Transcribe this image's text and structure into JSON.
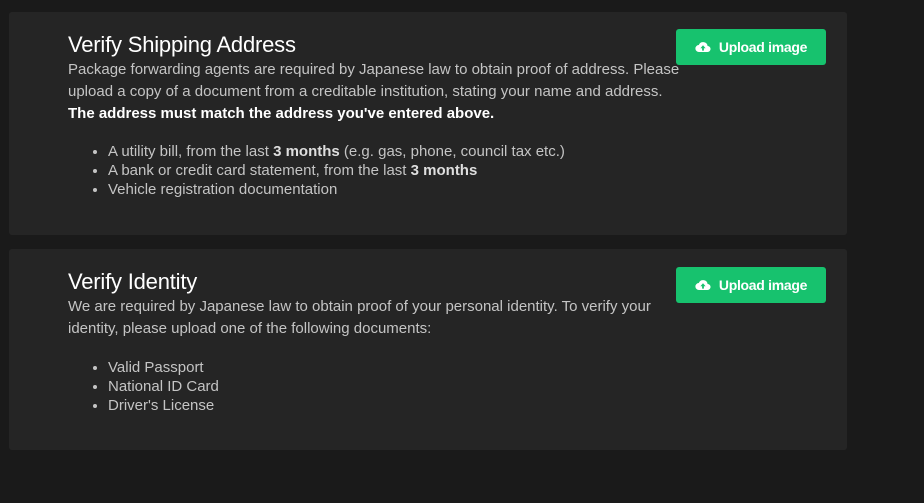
{
  "shipping": {
    "title": "Verify Shipping Address",
    "description": "Package forwarding agents are required by Japanese law to obtain proof of address. Please upload a copy of a document from a creditable institution, stating your name and address. ",
    "emphasis": "The address must match the address you've entered above.",
    "upload_label": "Upload image",
    "documents": [
      {
        "before": "A utility bill, from the last ",
        "bold": "3 months",
        "after": " (e.g. gas, phone, council tax etc.)"
      },
      {
        "before": "A bank or credit card statement, from the last ",
        "bold": "3 months",
        "after": ""
      },
      {
        "before": "Vehicle registration documentation",
        "bold": "",
        "after": ""
      }
    ]
  },
  "identity": {
    "title": "Verify Identity",
    "description": "We are required by Japanese law to obtain proof of your personal identity. To verify your identity, please upload one of the following documents:",
    "upload_label": "Upload image",
    "documents": [
      "Valid Passport",
      "National ID Card",
      "Driver's License"
    ]
  },
  "colors": {
    "page_background": "#1a1a1a",
    "card_background": "#252525",
    "accent": "#17c26e",
    "title_text": "#ffffff",
    "body_text": "#c4c4c4"
  },
  "icons": {
    "upload": "cloud-upload-icon"
  }
}
